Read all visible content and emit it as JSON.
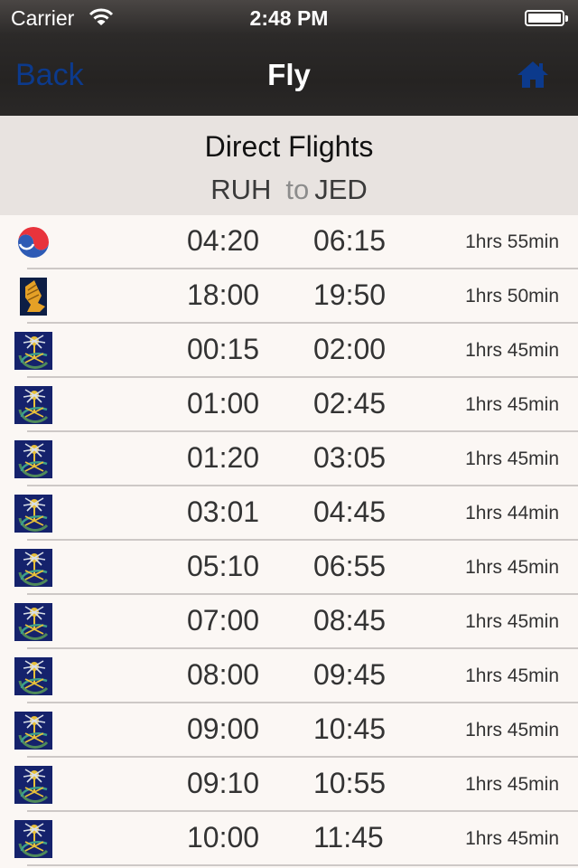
{
  "status_bar": {
    "carrier": "Carrier",
    "time": "2:48 PM",
    "battery_level": 1.0,
    "wifi_icon": "wifi-icon",
    "battery_icon": "battery-icon"
  },
  "nav": {
    "back_label": "Back",
    "title": "Fly",
    "home_icon": "home-icon",
    "accent": "#0c3a8c"
  },
  "header": {
    "title": "Direct Flights",
    "origin": "RUH",
    "connector": "to",
    "destination": "JED"
  },
  "flights": [
    {
      "airline_logo": "korean-air-logo",
      "departure": "04:20",
      "arrival": "06:15",
      "duration": "1hrs 55min"
    },
    {
      "airline_logo": "singapore-airlines-logo",
      "departure": "18:00",
      "arrival": "19:50",
      "duration": "1hrs 50min"
    },
    {
      "airline_logo": "saudia-logo",
      "departure": "00:15",
      "arrival": "02:00",
      "duration": "1hrs 45min"
    },
    {
      "airline_logo": "saudia-logo",
      "departure": "01:00",
      "arrival": "02:45",
      "duration": "1hrs 45min"
    },
    {
      "airline_logo": "saudia-logo",
      "departure": "01:20",
      "arrival": "03:05",
      "duration": "1hrs 45min"
    },
    {
      "airline_logo": "saudia-logo",
      "departure": "03:01",
      "arrival": "04:45",
      "duration": "1hrs 44min"
    },
    {
      "airline_logo": "saudia-logo",
      "departure": "05:10",
      "arrival": "06:55",
      "duration": "1hrs 45min"
    },
    {
      "airline_logo": "saudia-logo",
      "departure": "07:00",
      "arrival": "08:45",
      "duration": "1hrs 45min"
    },
    {
      "airline_logo": "saudia-logo",
      "departure": "08:00",
      "arrival": "09:45",
      "duration": "1hrs 45min"
    },
    {
      "airline_logo": "saudia-logo",
      "departure": "09:00",
      "arrival": "10:45",
      "duration": "1hrs 45min"
    },
    {
      "airline_logo": "saudia-logo",
      "departure": "09:10",
      "arrival": "10:55",
      "duration": "1hrs 45min"
    },
    {
      "airline_logo": "saudia-logo",
      "departure": "10:00",
      "arrival": "11:45",
      "duration": "1hrs 45min"
    }
  ]
}
